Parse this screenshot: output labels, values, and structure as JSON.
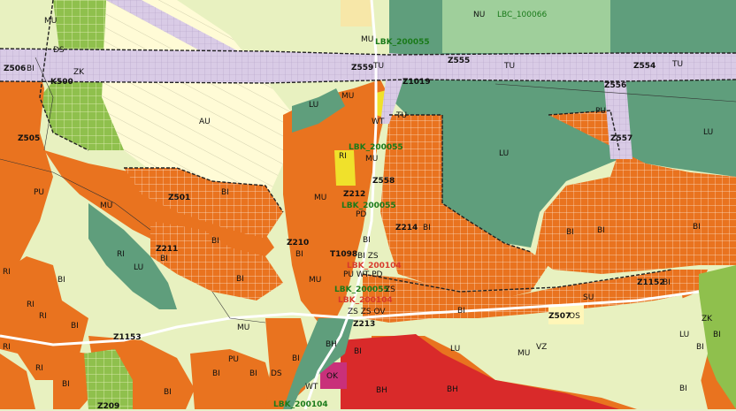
{
  "colors": {
    "bydleni_bi": "#e9731f",
    "bydleni_bh": "#d92a2a",
    "rekreace_ri": "#e8f1c0",
    "smisene_mu": "#e8f1c0",
    "les_lu": "#5f9e7c",
    "dopravni_tu": "#d9cbe6",
    "zahrada_zk": "#8fc04d",
    "ok_pink": "#c9307a",
    "sv_yellow": "#f0e12b",
    "au_field": "#fffbd6"
  },
  "labels": {
    "nu": "NU",
    "lbc_100066": "LBC_100066",
    "mu_top": "MU",
    "lbk_200055_top": "LBK_200055",
    "ds_top": "DS",
    "zk_left": "ZK",
    "z506": "Z506",
    "bi_z506": "BI",
    "k500": "K500",
    "au": "AU",
    "z559": "Z559",
    "tu_z559": "TU",
    "z555": "Z555",
    "tu_mid": "TU",
    "z554": "Z554",
    "tu_right": "TU",
    "z1019": "Z1019",
    "z556": "Z556",
    "mu_center": "MU",
    "lu_center_top": "LU",
    "wt": "WT",
    "tu_center": "TU",
    "pu_z557": "PU",
    "z557": "Z557",
    "lu_right": "LU",
    "z505": "Z505",
    "lbk_200055_center": "LBK_200055",
    "ri_center": "RI",
    "mu_center2": "MU",
    "lu_big": "LU",
    "z558": "Z558",
    "z501": "Z501",
    "bi_z501": "BI",
    "pu_left": "PU",
    "z212": "Z212",
    "mu_center3": "MU",
    "lbk_200055_mid": "LBK_200055",
    "pd": "PD",
    "mu_left": "MU",
    "z214": "Z214",
    "bi_z214": "BI",
    "bi_right1": "BI",
    "bi_right2": "BI",
    "bi_right3": "BI",
    "ri_left": "RI",
    "z211": "Z211",
    "bi_z211": "BI",
    "bi_mid": "BI",
    "z210": "Z210",
    "bi_z210": "BI",
    "bi_center": "BI",
    "lu_left": "LU",
    "t1098": "T1098",
    "bi_zs": "BI ZS",
    "lbk_200104_a": "LBK_200104",
    "pu_wt_pd": "PU WT PD",
    "ri_far_left": "RI",
    "bi_left1": "BI",
    "mu_left2": "MU",
    "bi_left2": "BI",
    "lbk_200055_zs": "LBK_200055",
    "zs_a": "ZS",
    "lbk_200104_b": "LBK_200104",
    "z1152": "Z1152",
    "bi_z1152": "BI",
    "su": "SU",
    "zk_right": "ZK",
    "bi_center2": "BI",
    "zszsov": "ZS ZS OV",
    "z507": "Z507",
    "os": "OS",
    "ri_left2": "RI",
    "z213": "Z213",
    "bi_left3": "BI",
    "z1153": "Z1153",
    "mu_bottom": "MU",
    "bh_a": "BH",
    "bi_bottom_l": "BI",
    "lu_bottom": "LU",
    "mu_bottom2": "MU",
    "vz": "VZ",
    "lu_bottom_r": "LU",
    "bi_far_right": "BI",
    "bi_far_right2": "BI",
    "pu_bottom": "PU",
    "ri_bottom": "RI",
    "ri_bottom2": "RI",
    "bi_bottom_c": "BI",
    "ds_bottom": "DS",
    "wt_bottom": "WT",
    "ok": "OK",
    "bh_b": "BH",
    "bh_c": "BH",
    "bi_bottom2": "BI",
    "bi_bottom3": "BI",
    "z209": "Z209",
    "lbk_200104_c": "LBK_200104",
    "ri_b3": "RI",
    "bi_b4": "BI",
    "bi_b5": "BI",
    "bi_b6": "BI"
  }
}
